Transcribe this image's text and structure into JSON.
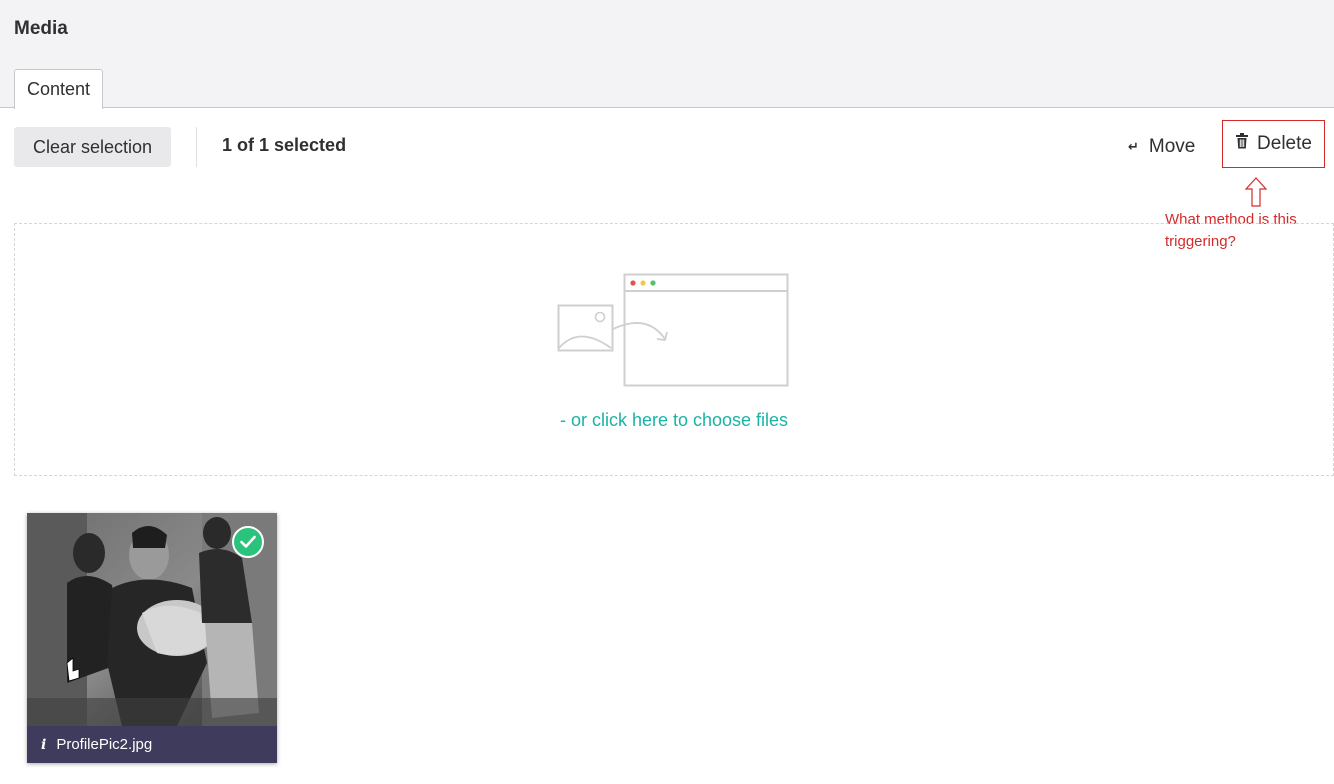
{
  "header": {
    "title": "Media",
    "tabs": [
      {
        "label": "Content"
      }
    ]
  },
  "toolbar": {
    "clear_label": "Clear selection",
    "selection_count": "1 of 1 selected",
    "move_label": "Move",
    "delete_label": "Delete"
  },
  "annotation": {
    "text": "What method is this triggering?"
  },
  "dropzone": {
    "link_text": "- or click here to choose files",
    "icon": "upload-illustration"
  },
  "media_items": [
    {
      "name": "ProfilePic2.jpg",
      "selected": true
    }
  ],
  "colors": {
    "accent": "#1ab3a6",
    "annotation": "#d42a2a",
    "selected_badge": "#2bc37c",
    "card_footer": "#3e3b5c"
  }
}
